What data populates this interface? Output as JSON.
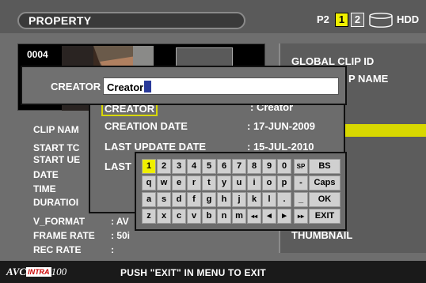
{
  "header": {
    "title": "PROPERTY",
    "p2_label": "P2",
    "slot1": "1",
    "slot2": "2",
    "hdd_label": "HDD",
    "hdd_icon": "hdd-icon"
  },
  "clip": {
    "number": "0004",
    "left_labels": [
      "CLIP NAM",
      "START TC",
      "START UE",
      "DATE",
      "TIME",
      "DURATIOI"
    ],
    "v_format_label": "V_FORMAT",
    "v_format_value": ": AV",
    "frame_rate_label": "FRAME RATE",
    "frame_rate_value": ": 50i",
    "rec_rate_label": "REC RATE",
    "rec_rate_value": ":"
  },
  "right_panel": {
    "global_clip_id": "GLOBAL CLIP ID",
    "name_fragment": "P NAME",
    "thumbnail": "THUMBNAIL"
  },
  "detail": {
    "creator_row": "CREATOR",
    "creator_row_value": ": Creator",
    "rows": [
      {
        "label": "CREATION DATE",
        "value": ":  17-JUN-2009"
      },
      {
        "label": "LAST UPDATE DATE",
        "value": ":  15-JUL-2010"
      },
      {
        "label": "LAST",
        "value": ""
      }
    ]
  },
  "creator_input": {
    "label": "CREATOR",
    "value": "Creator"
  },
  "keyboard": {
    "rows": [
      [
        "1",
        "2",
        "3",
        "4",
        "5",
        "6",
        "7",
        "8",
        "9",
        "0",
        "SP",
        "BS"
      ],
      [
        "q",
        "w",
        "e",
        "r",
        "t",
        "y",
        "u",
        "i",
        "o",
        "p",
        "-",
        "Caps"
      ],
      [
        "a",
        "s",
        "d",
        "f",
        "g",
        "h",
        "j",
        "k",
        "l",
        ".",
        "_",
        "OK"
      ],
      [
        "z",
        "x",
        "c",
        "v",
        "b",
        "n",
        "m",
        "◂◂",
        "◂",
        "▸",
        "▸▸",
        "EXIT"
      ]
    ],
    "selected": "1"
  },
  "footer": {
    "logo_avc": "AVC",
    "logo_intra": "INTRA",
    "logo_100": "100",
    "message": "PUSH \"EXIT\" IN MENU TO EXIT"
  },
  "colors": {
    "background": "#6e6e6e",
    "highlight": "#f0f000",
    "panel_border": "#111111"
  }
}
